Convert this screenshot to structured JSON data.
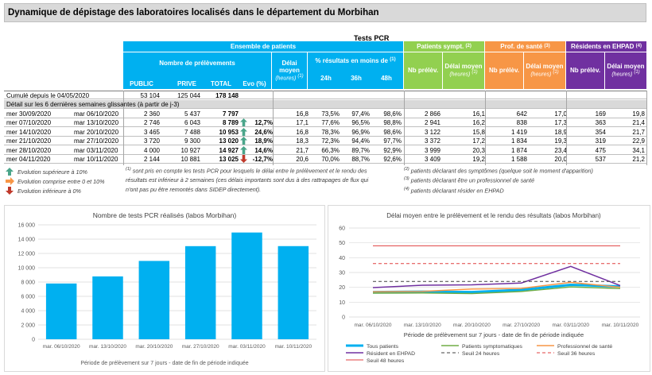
{
  "title": "Dynamique de dépistage des laboratoires localisés dans le département du Morbihan",
  "table": {
    "title": "Tests PCR",
    "group_all": "Ensemble de patients",
    "group_sympt": "Patients sympt.",
    "group_sympt_note": "(2)",
    "group_prof": "Prof. de santé",
    "group_prof_note": "(3)",
    "group_ehpad": "Résidents en EHPAD",
    "group_ehpad_note": "(4)",
    "nb_prelevements": "Nombre de prélèvements",
    "delai_moyen": "Délai moyen",
    "heures_note": "(heures)",
    "note1": "(1)",
    "pct_results": "% résultats en moins de",
    "h24": "24h",
    "h36": "36h",
    "h48": "48h",
    "col_public": "PUBLIC",
    "col_prive": "PRIVE",
    "col_total": "TOTAL",
    "col_evo": "Evo (%)",
    "nb_prelev": "Nb prélèv.",
    "cumul_label": "Cumulé depuis le 04/05/2020",
    "cumul_public": "53 104",
    "cumul_prive": "125 044",
    "cumul_total": "178 148",
    "detail_label": "Détail sur les 6 dernières semaines glissantes (à partir de j-3)",
    "rows": [
      {
        "from": "mer 30/09/2020",
        "to": "mar 06/10/2020",
        "public": "2 360",
        "prive": "5 437",
        "total": "7 797",
        "evo": "",
        "trend": "",
        "delai": "16,8",
        "p24": "73,5%",
        "p36": "97,4%",
        "p48": "98,6%",
        "s_nb": "2 866",
        "s_delai": "16,1",
        "ps_nb": "642",
        "ps_delai": "17,0",
        "e_nb": "169",
        "e_delai": "19,8"
      },
      {
        "from": "mer 07/10/2020",
        "to": "mar 13/10/2020",
        "public": "2 746",
        "prive": "6 043",
        "total": "8 789",
        "evo": "12,7%",
        "trend": "up",
        "delai": "17,1",
        "p24": "77,6%",
        "p36": "96,5%",
        "p48": "98,8%",
        "s_nb": "2 941",
        "s_delai": "16,2",
        "ps_nb": "838",
        "ps_delai": "17,3",
        "e_nb": "363",
        "e_delai": "21,4"
      },
      {
        "from": "mer 14/10/2020",
        "to": "mar 20/10/2020",
        "public": "3 465",
        "prive": "7 488",
        "total": "10 953",
        "evo": "24,6%",
        "trend": "up",
        "delai": "16,8",
        "p24": "78,3%",
        "p36": "96,9%",
        "p48": "98,6%",
        "s_nb": "3 122",
        "s_delai": "15,8",
        "ps_nb": "1 419",
        "ps_delai": "18,9",
        "e_nb": "354",
        "e_delai": "21,7"
      },
      {
        "from": "mer 21/10/2020",
        "to": "mar 27/10/2020",
        "public": "3 720",
        "prive": "9 300",
        "total": "13 020",
        "evo": "18,9%",
        "trend": "up",
        "delai": "18,3",
        "p24": "72,3%",
        "p36": "94,4%",
        "p48": "97,7%",
        "s_nb": "3 372",
        "s_delai": "17,2",
        "ps_nb": "1 834",
        "ps_delai": "19,3",
        "e_nb": "319",
        "e_delai": "22,9"
      },
      {
        "from": "mer 28/10/2020",
        "to": "mar 03/11/2020",
        "public": "4 000",
        "prive": "10 927",
        "total": "14 927",
        "evo": "14,6%",
        "trend": "up",
        "delai": "21,7",
        "p24": "66,3%",
        "p36": "89,7%",
        "p48": "92,9%",
        "s_nb": "3 999",
        "s_delai": "20,3",
        "ps_nb": "1 874",
        "ps_delai": "23,4",
        "e_nb": "475",
        "e_delai": "34,1"
      },
      {
        "from": "mer 04/11/2020",
        "to": "mar 10/11/2020",
        "public": "2 144",
        "prive": "10 881",
        "total": "13 025",
        "evo": "-12,7%",
        "trend": "down",
        "delai": "20,6",
        "p24": "70,0%",
        "p36": "88,7%",
        "p48": "92,6%",
        "s_nb": "3 409",
        "s_delai": "19,2",
        "ps_nb": "1 588",
        "ps_delai": "20,0",
        "e_nb": "537",
        "e_delai": "21,2"
      }
    ]
  },
  "legend": {
    "up": "Evolution supérieure à 10%",
    "mid": "Evolution comprise entre 0 et 10%",
    "down": "Evolution inférieure à 0%",
    "n1": "(1)",
    "note1_l1": "sont pris en compte les tests PCR pour lesquels le délai entre le prélèvement et le rendu des",
    "note1_l2": "résultats est inférieur à 2 semaines (ces délais importants sont dus à des rattrapages de flux qui",
    "note1_l3": "n'ont pas pu être remontés dans SIDEP directement).",
    "n2": "(2)",
    "note2": "patients déclarant des symptômes (quelque soit le moment d'apparition)",
    "n3": "(3)",
    "note3_l1": "patients déclarant être un professionnel de santé",
    "n4": "(4)",
    "note4": "patients déclarant résider en EHPAD"
  },
  "colors": {
    "blue": "#00b0f0",
    "green": "#92d050",
    "orange": "#f79646",
    "purple": "#7030a0",
    "arrow_up": "#4aa58a",
    "arrow_mid": "#f79646",
    "arrow_down": "#c0392b"
  },
  "chart_data": [
    {
      "type": "bar",
      "title": "Nombre de tests PCR réalisés (labos Morbihan)",
      "xlabel": "Période de prélèvement sur 7 jours - date de fin de période indiquée",
      "categories": [
        "mar. 06/10/2020",
        "mar. 13/10/2020",
        "mar. 20/10/2020",
        "mar. 27/10/2020",
        "mar. 03/11/2020",
        "mar. 10/11/2020"
      ],
      "values": [
        7797,
        8789,
        10953,
        13020,
        14927,
        13025
      ],
      "ylim": [
        0,
        16000
      ],
      "yticks": [
        "0",
        "2 000",
        "4 000",
        "6 000",
        "8 000",
        "10 000",
        "12 000",
        "14 000",
        "16 000"
      ],
      "color": "#00b0f0",
      "grid": true
    },
    {
      "type": "line",
      "title": "Délai moyen entre le prélèvement et le rendu des résultats (labos Morbihan)",
      "xlabel": "Période de prélèvement sur 7 jours - date de fin de période indiquée",
      "categories": [
        "mar. 06/10/2020",
        "mar. 13/10/2020",
        "mar. 20/10/2020",
        "mar. 27/10/2020",
        "mar. 03/11/2020",
        "mar. 10/11/2020"
      ],
      "ylim": [
        0,
        60
      ],
      "yticks": [
        "0",
        "10",
        "20",
        "30",
        "40",
        "50",
        "60"
      ],
      "grid": true,
      "legend_position": "bottom",
      "series": [
        {
          "name": "Tous patients",
          "values": [
            16.8,
            17.1,
            16.8,
            18.3,
            21.7,
            20.6
          ],
          "color": "#00b0f0",
          "dash": "",
          "width": 3
        },
        {
          "name": "Patients symptomatiques",
          "values": [
            16.1,
            16.2,
            15.8,
            17.2,
            20.3,
            19.2
          ],
          "color": "#70ad47",
          "dash": "",
          "width": 1.5
        },
        {
          "name": "Professionnel de santé",
          "values": [
            17.0,
            17.3,
            18.9,
            19.3,
            23.4,
            20.0
          ],
          "color": "#f79646",
          "dash": "",
          "width": 1.5
        },
        {
          "name": "Résident en EHPAD",
          "values": [
            19.8,
            21.4,
            21.7,
            22.9,
            34.1,
            21.2
          ],
          "color": "#7030a0",
          "dash": "",
          "width": 1.5
        },
        {
          "name": "Seuil 24 heures",
          "values": [
            24,
            24,
            24,
            24,
            24,
            24
          ],
          "color": "#404040",
          "dash": "4,3",
          "width": 1
        },
        {
          "name": "Seuil 36 heures",
          "values": [
            36,
            36,
            36,
            36,
            36,
            36
          ],
          "color": "#e04040",
          "dash": "4,3",
          "width": 1
        },
        {
          "name": "Seuil 48 heures",
          "values": [
            48,
            48,
            48,
            48,
            48,
            48
          ],
          "color": "#e04040",
          "dash": "",
          "width": 1
        }
      ]
    }
  ]
}
